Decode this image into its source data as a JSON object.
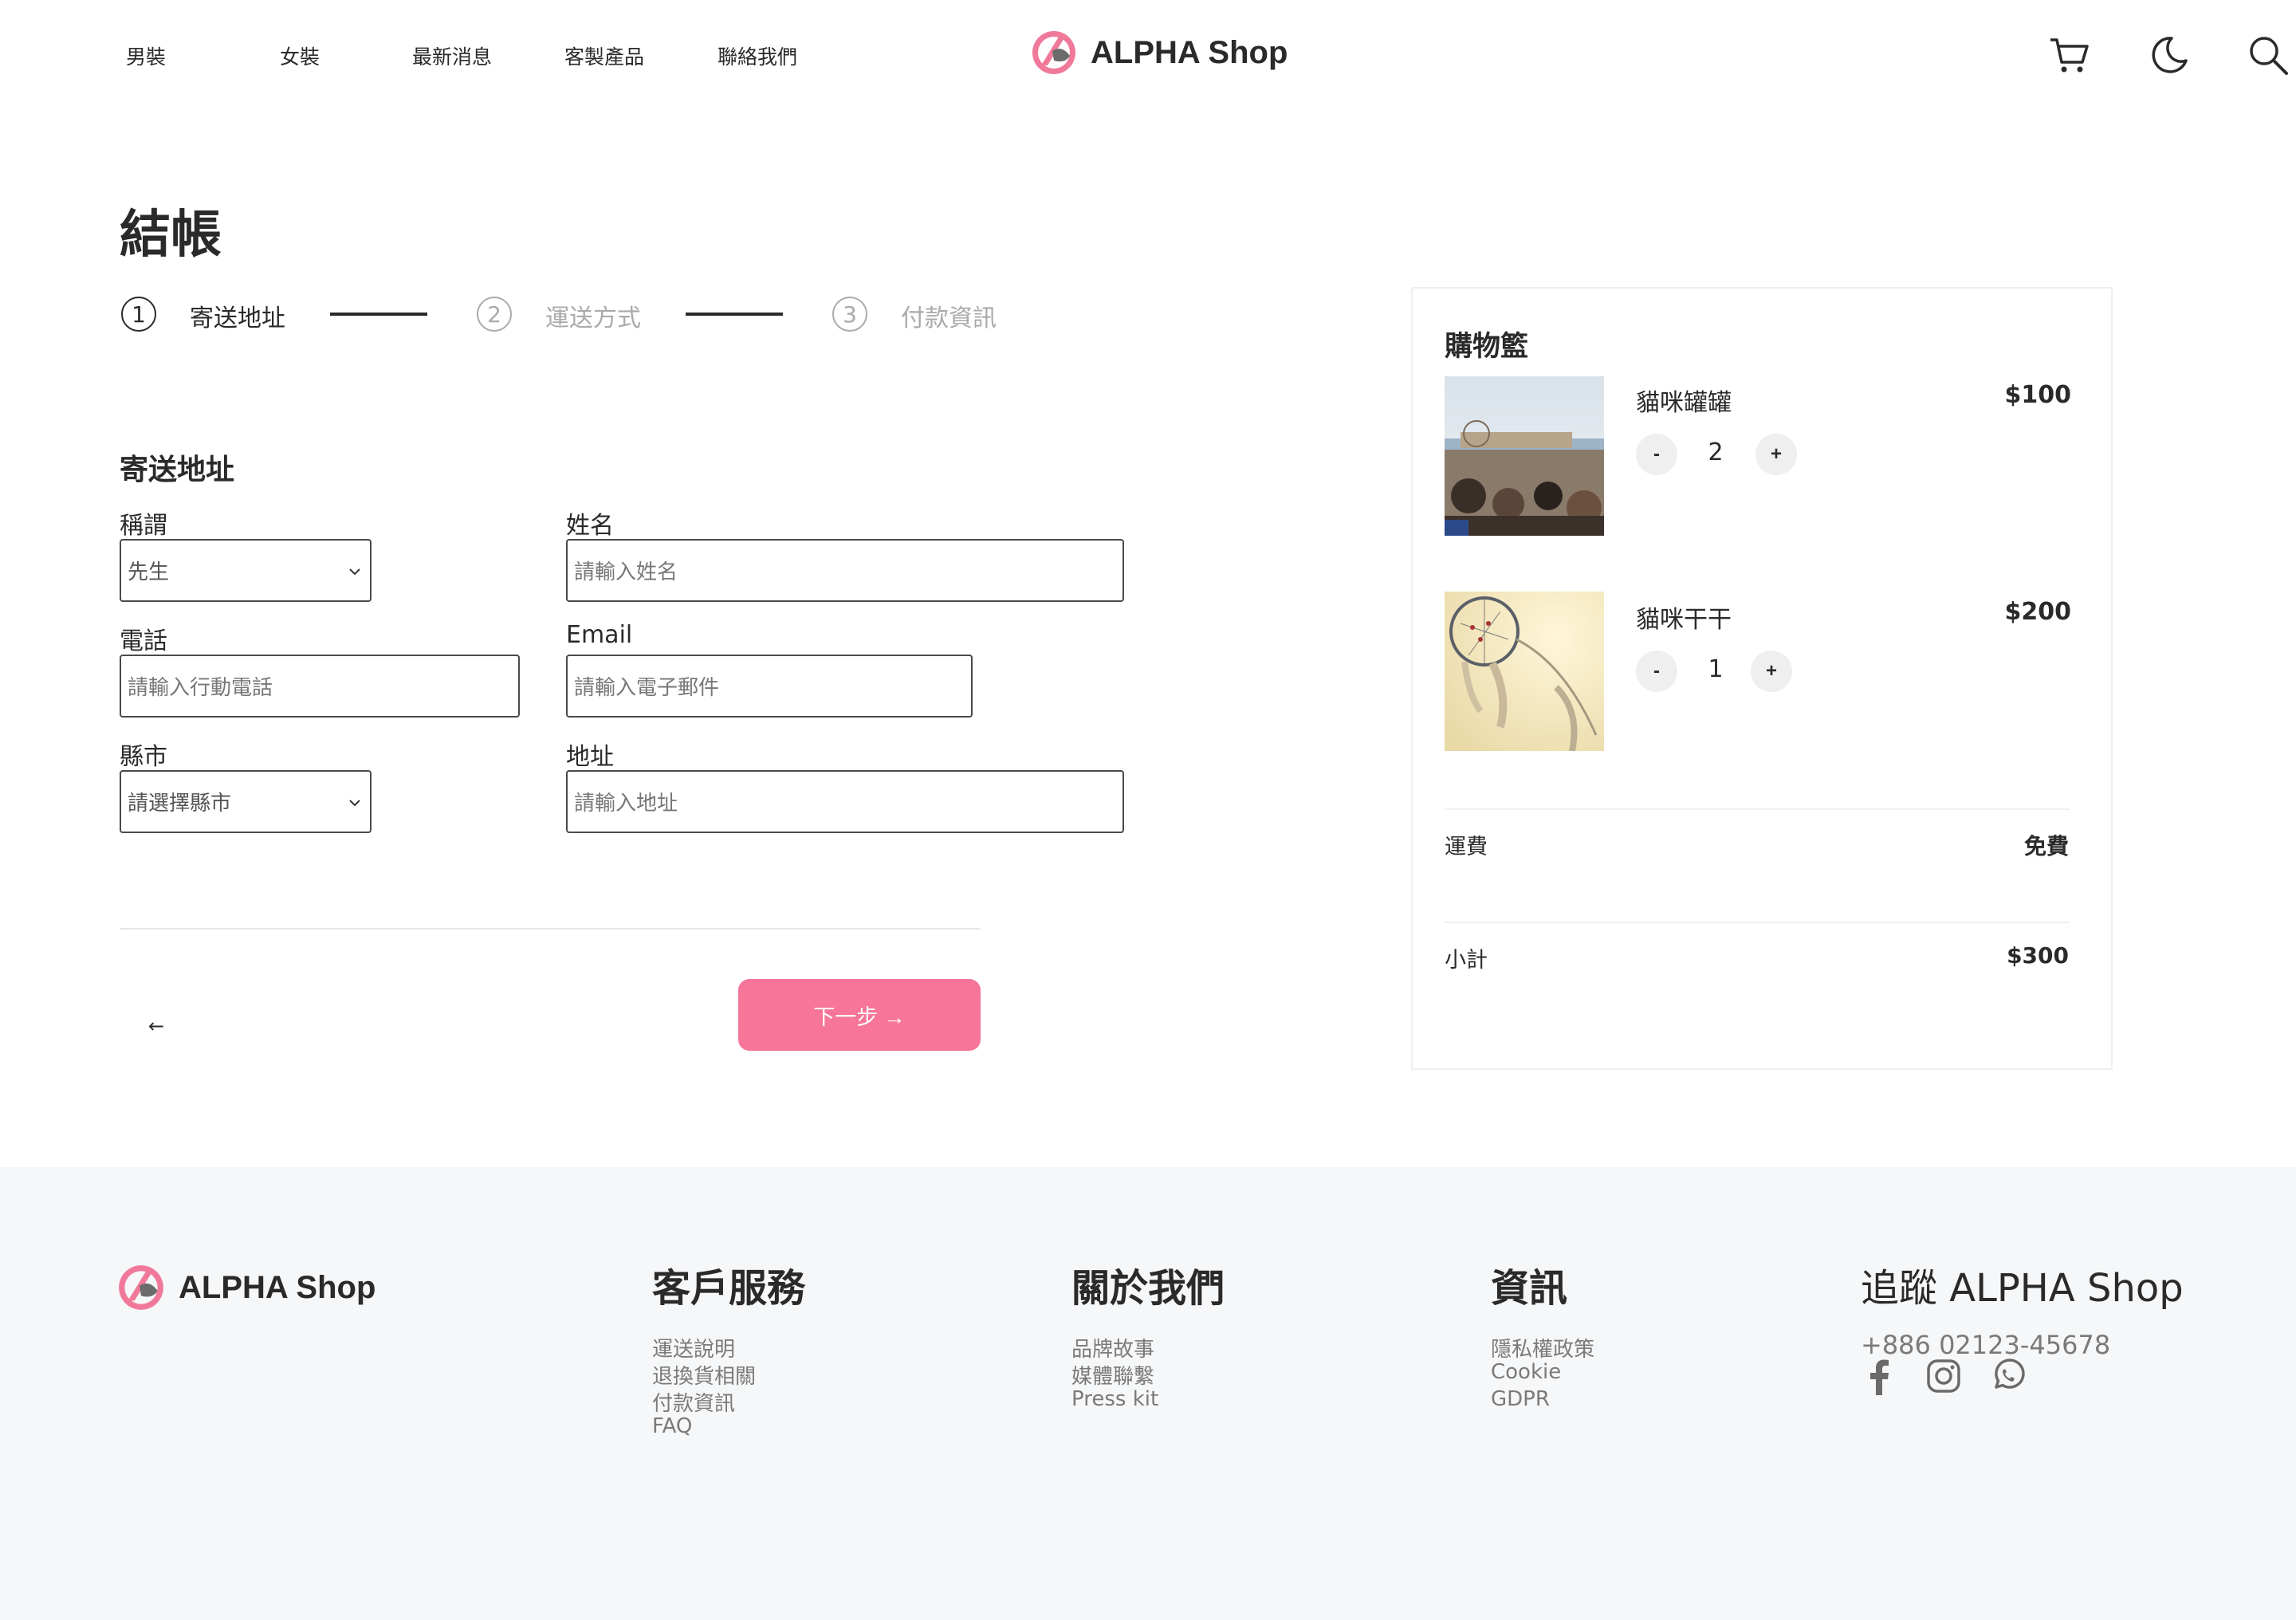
{
  "header": {
    "nav": [
      "男裝",
      "女裝",
      "最新消息",
      "客製產品",
      "聯絡我們"
    ],
    "brand": "ALPHA Shop",
    "icons": [
      "cart-icon",
      "moon-icon",
      "search-icon"
    ]
  },
  "checkout": {
    "title": "結帳",
    "steps": [
      {
        "number": "1",
        "label": "寄送地址",
        "active": true
      },
      {
        "number": "2",
        "label": "運送方式",
        "active": false
      },
      {
        "number": "3",
        "label": "付款資訊",
        "active": false
      }
    ],
    "section_title": "寄送地址",
    "fields": {
      "salutation": {
        "label": "稱謂",
        "value": "先生"
      },
      "name": {
        "label": "姓名",
        "placeholder": "請輸入姓名"
      },
      "phone": {
        "label": "電話",
        "placeholder": "請輸入行動電話"
      },
      "email": {
        "label": "Email",
        "placeholder": "請輸入電子郵件"
      },
      "city": {
        "label": "縣市",
        "value": "請選擇縣市"
      },
      "address": {
        "label": "地址",
        "placeholder": "請輸入地址"
      }
    },
    "back_label": "←",
    "next_label": "下一步 →"
  },
  "cart": {
    "title": "購物籃",
    "items": [
      {
        "name": "貓咪罐罐",
        "price": "$100",
        "quantity": "2",
        "minus": "-",
        "plus": "+"
      },
      {
        "name": "貓咪干干",
        "price": "$200",
        "quantity": "1",
        "minus": "-",
        "plus": "+"
      }
    ],
    "shipping": {
      "label": "運費",
      "value": "免費"
    },
    "subtotal": {
      "label": "小計",
      "value": "$300"
    }
  },
  "footer": {
    "brand": "ALPHA Shop",
    "columns": [
      {
        "title": "客戶服務",
        "links": [
          "運送說明",
          "退換貨相關",
          "付款資訊",
          "FAQ"
        ]
      },
      {
        "title": "關於我們",
        "links": [
          "品牌故事",
          "媒體聯繫",
          "Press kit"
        ]
      },
      {
        "title": "資訊",
        "links": [
          "隱私權政策",
          "Cookie",
          "GDPR"
        ]
      }
    ],
    "follow": {
      "title": "追蹤 ALPHA Shop",
      "phone": "+886 02123-45678",
      "social": [
        "facebook-icon",
        "instagram-icon",
        "whatsapp-icon"
      ]
    }
  },
  "colors": {
    "accent": "#f67599",
    "brand_pink": "#f0799a",
    "footer_bg": "#f6f7f8",
    "text": "#2a2a2a"
  }
}
